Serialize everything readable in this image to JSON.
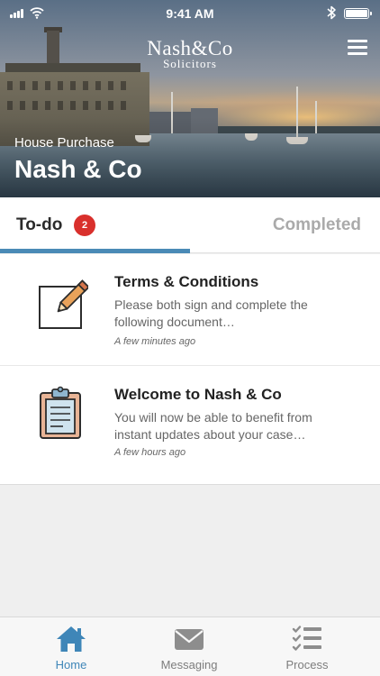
{
  "status_bar": {
    "time": "9:41 AM"
  },
  "brand": {
    "logo_main": "Nash&Co",
    "logo_sub": "Solicitors"
  },
  "header": {
    "subtitle": "House Purchase",
    "title": "Nash & Co"
  },
  "tabs": [
    {
      "label": "To-do",
      "badge": "2",
      "active": true
    },
    {
      "label": "Completed",
      "active": false
    }
  ],
  "items": [
    {
      "title": "Terms & Conditions",
      "description": "Please both sign and complete the following document…",
      "time": "A few minutes ago",
      "icon": "edit-document-icon"
    },
    {
      "title": "Welcome to Nash & Co",
      "description": "You will now be able to benefit from instant updates about your case…",
      "time": "A few hours ago",
      "icon": "clipboard-icon"
    }
  ],
  "bottom_nav": [
    {
      "label": "Home",
      "icon": "home-icon",
      "active": true
    },
    {
      "label": "Messaging",
      "icon": "message-icon",
      "active": false
    },
    {
      "label": "Process",
      "icon": "checklist-icon",
      "active": false
    }
  ],
  "colors": {
    "accent": "#4a8ab6",
    "badge": "#d9302c",
    "active_nav": "#3f86b8",
    "inactive_nav": "#7d7d7d"
  }
}
